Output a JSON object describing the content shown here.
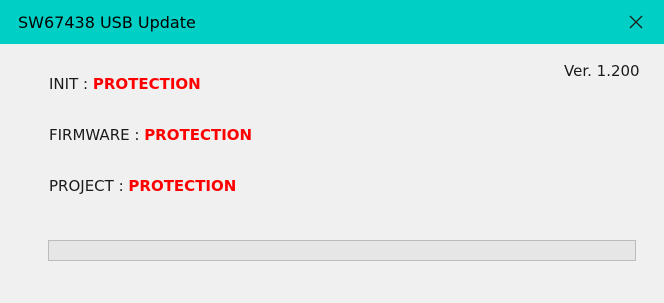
{
  "window": {
    "title": "SW67438 USB Update",
    "accent_color": "#00cfc5",
    "close_icon": "close-icon"
  },
  "version": "Ver. 1.200",
  "status": {
    "init_label": "INIT : ",
    "init_value": "PROTECTION",
    "firmware_label": "FIRMWARE : ",
    "firmware_value": "PROTECTION",
    "project_label": "PROJECT : ",
    "project_value": "PROTECTION",
    "value_color": "#ff0000"
  },
  "progress": {
    "fraction": 0.0
  }
}
